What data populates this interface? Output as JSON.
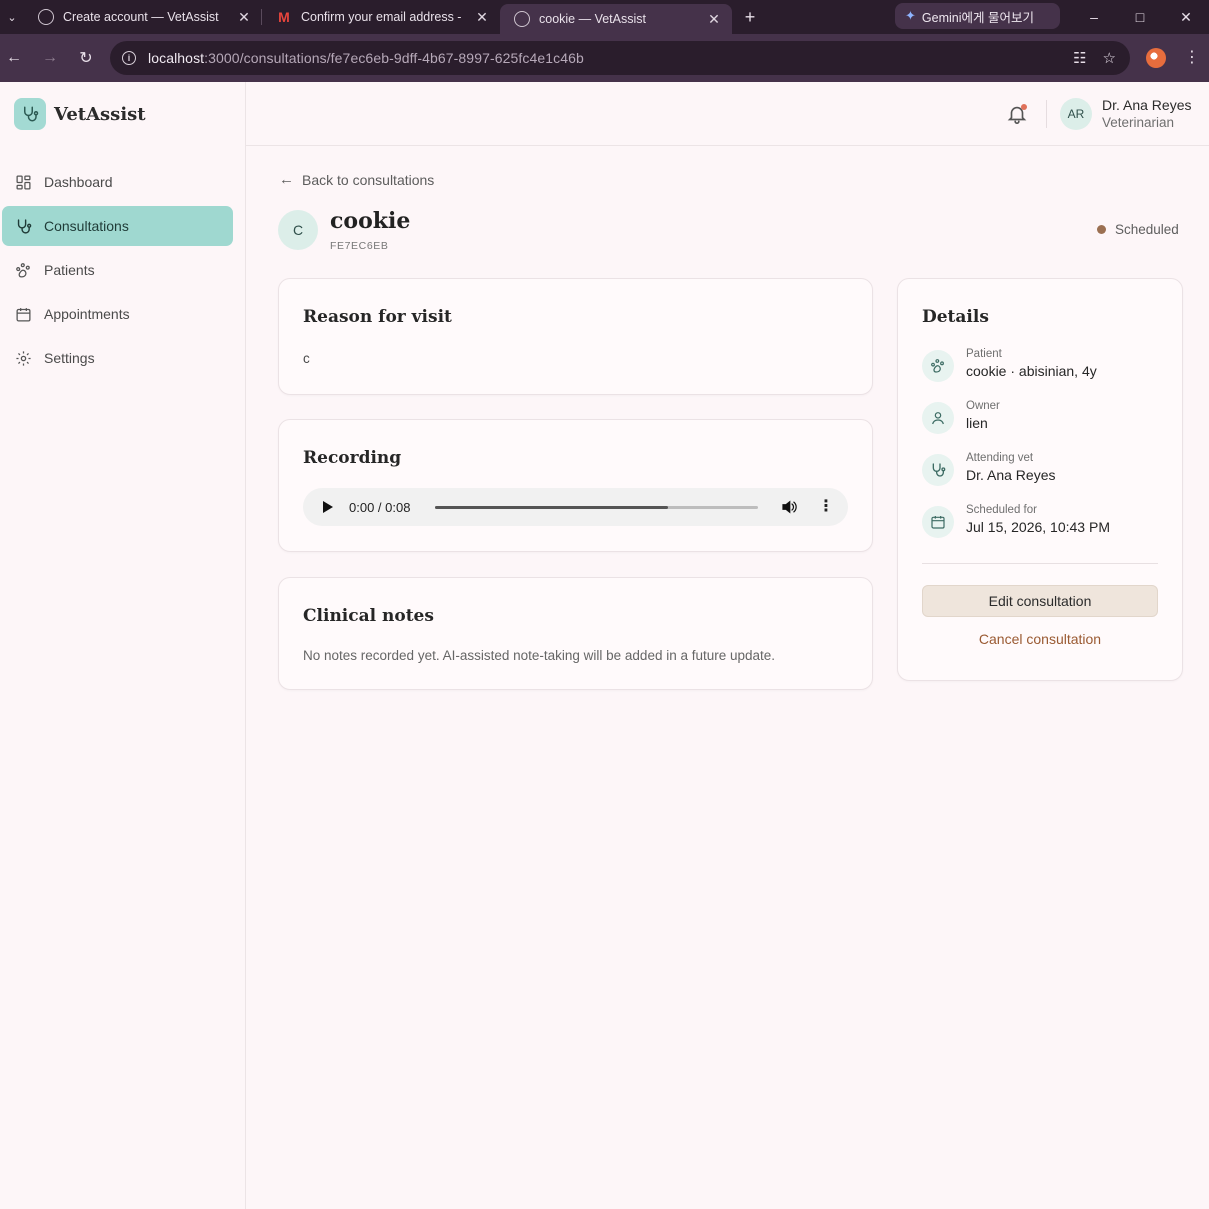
{
  "browser": {
    "tabs": [
      {
        "title": "Create account — VetAssist",
        "icon": "globe-icon"
      },
      {
        "title": "Confirm your email address - ",
        "icon": "gmail-icon"
      },
      {
        "title": "cookie — VetAssist",
        "icon": "globe-icon",
        "active": true
      }
    ],
    "gemini_label": "Gemini에게 물어보기",
    "url_host": "localhost",
    "url_rest": ":3000/consultations/fe7ec6eb-9dff-4b67-8997-625fc4e1c46b"
  },
  "app": {
    "brand": "VetAssist",
    "nav": [
      {
        "label": "Dashboard",
        "icon": "dashboard-icon"
      },
      {
        "label": "Consultations",
        "icon": "stethoscope-icon",
        "active": true
      },
      {
        "label": "Patients",
        "icon": "paw-icon"
      },
      {
        "label": "Appointments",
        "icon": "calendar-icon"
      },
      {
        "label": "Settings",
        "icon": "gear-icon"
      }
    ],
    "user": {
      "initials": "AR",
      "name": "Dr. Ana Reyes",
      "role": "Veterinarian"
    }
  },
  "consultation": {
    "back_label": "Back to consultations",
    "patient_initial": "C",
    "patient_name": "cookie",
    "short_id": "FE7EC6EB",
    "status": "Scheduled",
    "status_color": "#9b7052",
    "reason": {
      "title": "Reason for visit",
      "text": "c"
    },
    "recording": {
      "title": "Recording",
      "current_time": "0:00",
      "duration": "0:08",
      "progress": 0.72
    },
    "notes": {
      "title": "Clinical notes",
      "text": "No notes recorded yet. AI-assisted note-taking will be added in a future update."
    },
    "details": {
      "title": "Details",
      "rows": [
        {
          "label": "Patient",
          "value": "cookie · abisinian, 4y",
          "icon": "paw-icon"
        },
        {
          "label": "Owner",
          "value": "lien",
          "icon": "user-icon"
        },
        {
          "label": "Attending vet",
          "value": "Dr. Ana Reyes",
          "icon": "stethoscope-icon"
        },
        {
          "label": "Scheduled for",
          "value": "Jul 15, 2026, 10:43 PM",
          "icon": "calendar-icon"
        }
      ],
      "edit_label": "Edit consultation",
      "cancel_label": "Cancel consultation"
    }
  },
  "colors": {
    "accent": "#9fd8d0",
    "cancel": "#9a5a32"
  }
}
